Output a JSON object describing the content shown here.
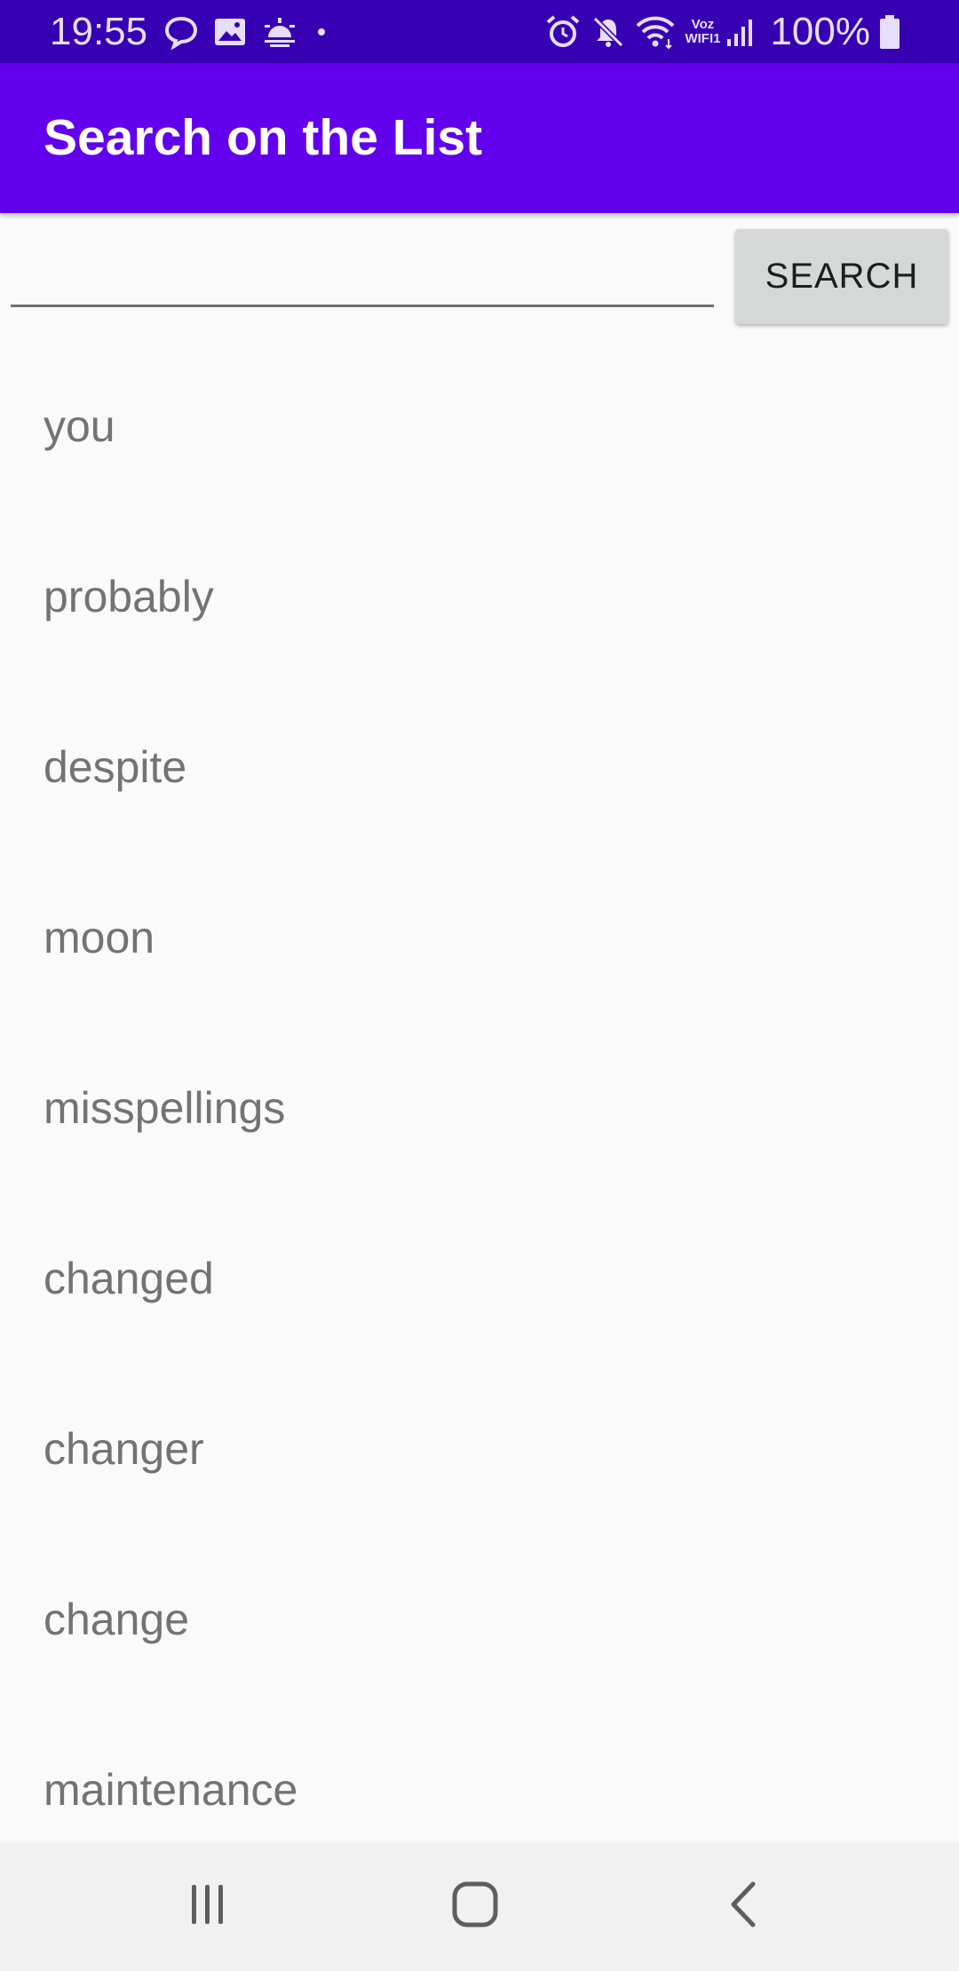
{
  "status_bar": {
    "time": "19:55",
    "left_icons": [
      "chat-icon",
      "image-icon",
      "sunrise-icon",
      "dot-icon"
    ],
    "right_icons": [
      "alarm-icon",
      "mute-icon",
      "wifi-icon",
      "signal-icon",
      "battery-icon"
    ],
    "voz_line1": "Voz",
    "voz_line2": "WIFI1",
    "battery": "100%"
  },
  "app_bar": {
    "title": "Search on the List",
    "color": "#6200ee",
    "status_color": "#3700b3"
  },
  "search": {
    "value": "",
    "button_label": "SEARCH"
  },
  "list": {
    "items": [
      "you",
      "probably",
      "despite",
      "moon",
      "misspellings",
      "changed",
      "changer",
      "change",
      "maintenance"
    ]
  },
  "nav_bar": {
    "buttons": [
      "recent-apps-icon",
      "home-icon",
      "back-icon"
    ]
  }
}
